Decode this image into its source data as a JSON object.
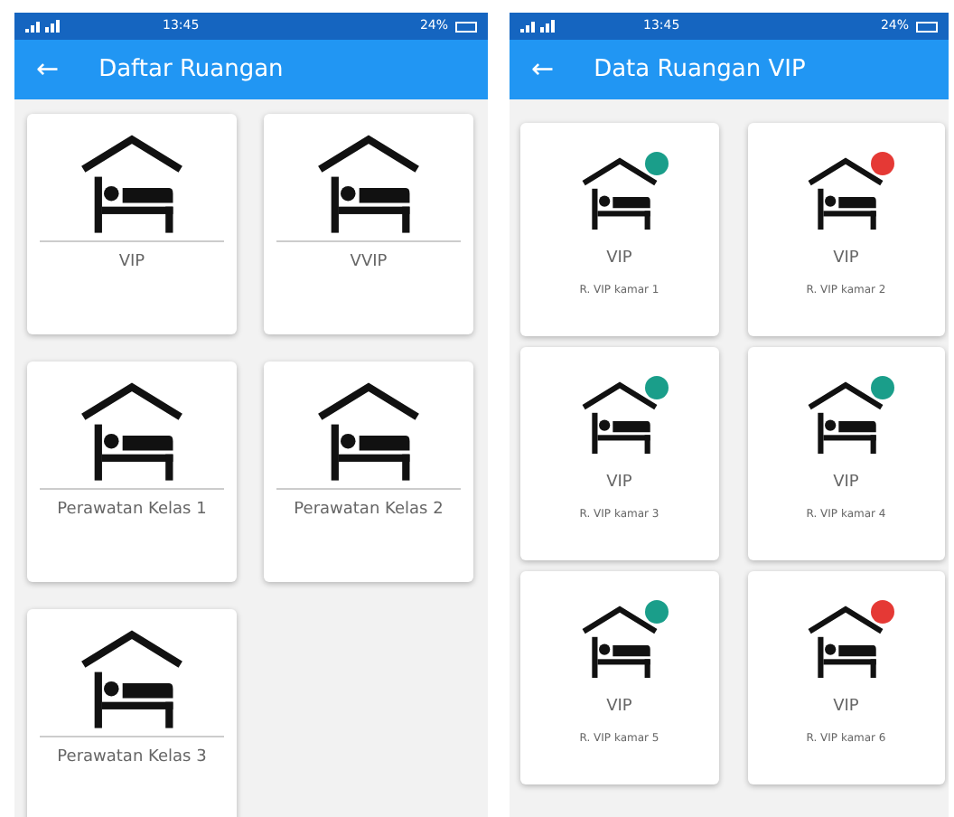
{
  "screens": [
    {
      "status_bar": {
        "time": "13:45",
        "battery": "24%"
      },
      "app_bar": {
        "back": "←",
        "title": "Daftar Ruangan"
      },
      "items": [
        {
          "kind": "category",
          "label": "VIP"
        },
        {
          "kind": "category",
          "label": "VVIP"
        },
        {
          "kind": "category",
          "label": "Perawatan Kelas 1"
        },
        {
          "kind": "category",
          "label": "Perawatan Kelas 2"
        },
        {
          "kind": "category",
          "label": "Perawatan Kelas 3"
        }
      ]
    },
    {
      "status_bar": {
        "time": "13:45",
        "battery": "24%"
      },
      "app_bar": {
        "back": "←",
        "title": "Data Ruangan VIP"
      },
      "items": [
        {
          "kind": "room",
          "label": "VIP",
          "sublabel": "R. VIP kamar 1",
          "color": "#1a9e8a"
        },
        {
          "kind": "room",
          "label": "VIP",
          "sublabel": "R. VIP kamar 2",
          "color": "#e53935"
        },
        {
          "kind": "room",
          "label": "VIP",
          "sublabel": "R. VIP kamar 3",
          "color": "#1a9e8a"
        },
        {
          "kind": "room",
          "label": "VIP",
          "sublabel": "R. VIP kamar 4",
          "color": "#1a9e8a"
        },
        {
          "kind": "room",
          "label": "VIP",
          "sublabel": "R. VIP kamar 5",
          "color": "#1a9e8a"
        },
        {
          "kind": "room",
          "label": "VIP",
          "sublabel": "R. VIP kamar 6",
          "color": "#e53935"
        }
      ]
    }
  ]
}
